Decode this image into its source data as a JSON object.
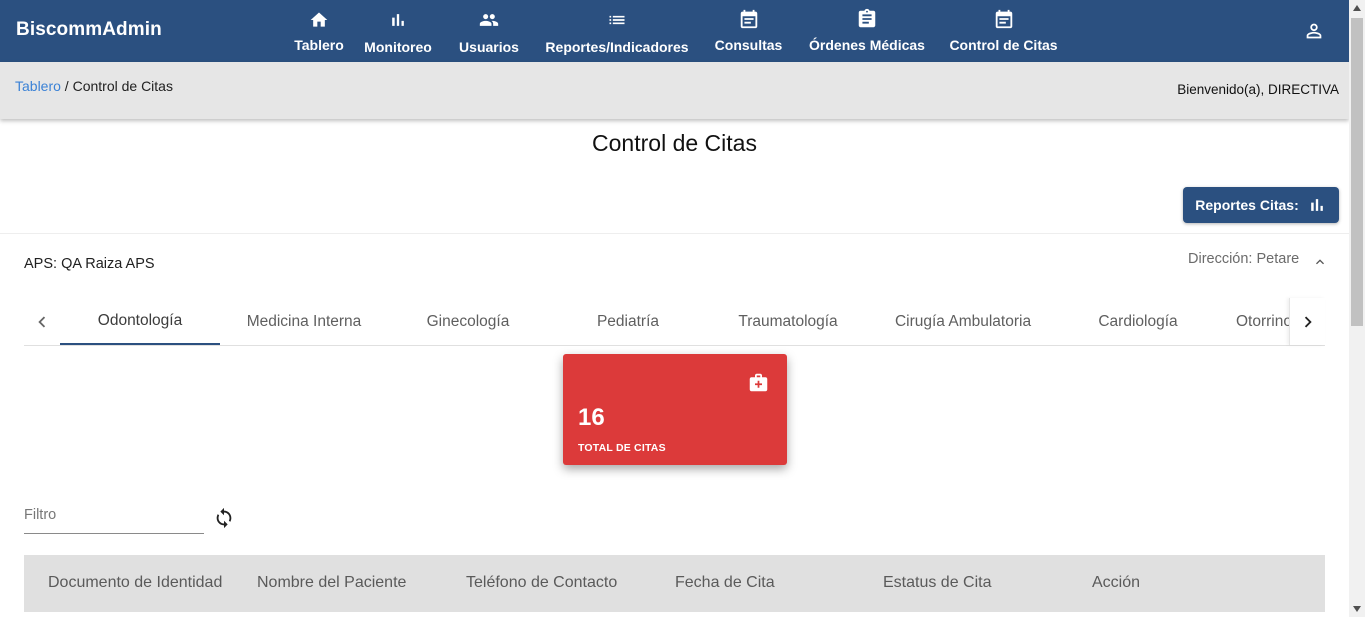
{
  "app": {
    "title": "BiscommAdmin"
  },
  "nav": {
    "items": [
      {
        "label": "Tablero",
        "icon": "home-icon"
      },
      {
        "label": "Monitoreo",
        "icon": "bar-chart-icon"
      },
      {
        "label": "Usuarios",
        "icon": "people-icon"
      },
      {
        "label": "Reportes/Indicadores",
        "icon": "list-icon"
      },
      {
        "label": "Consultas",
        "icon": "calendar-icon"
      },
      {
        "label": "Órdenes Médicas",
        "icon": "clipboard-icon"
      },
      {
        "label": "Control de Citas",
        "icon": "calendar-icon"
      }
    ],
    "user_icon": "person-icon"
  },
  "breadcrumb": {
    "link": "Tablero",
    "separator": " / ",
    "current": "Control de Citas"
  },
  "welcome": "Bienvenido(a), DIRECTIVA",
  "page_title": "Control de Citas",
  "report_button": {
    "label": "Reportes Citas:",
    "icon": "bar-chart-icon"
  },
  "section": {
    "aps_label": "APS: QA Raiza APS",
    "direccion": "Dirección: Petare",
    "toggle_icon": "chevron-up-icon"
  },
  "tabs": {
    "items": [
      "Odontología",
      "Medicina Interna",
      "Ginecología",
      "Pediatría",
      "Traumatología",
      "Cirugía Ambulatoria",
      "Cardiología",
      "Otorrinolaringología"
    ],
    "active": "Odontología"
  },
  "stat_card": {
    "value": "16",
    "label": "TOTAL DE CITAS",
    "icon": "medical-kit-icon",
    "color": "#dc3a3a"
  },
  "filter": {
    "placeholder": "Filtro",
    "value": ""
  },
  "table": {
    "columns": [
      "Documento de Identidad",
      "Nombre del Paciente",
      "Teléfono de Contacto",
      "Fecha de Cita",
      "Estatus de Cita",
      "Acción"
    ]
  },
  "colors": {
    "primary": "#2b5080",
    "link": "#3b82d6",
    "card": "#dc3a3a",
    "breadcrumb_bg": "#e6e6e6",
    "table_header_bg": "#e0e0e0"
  }
}
